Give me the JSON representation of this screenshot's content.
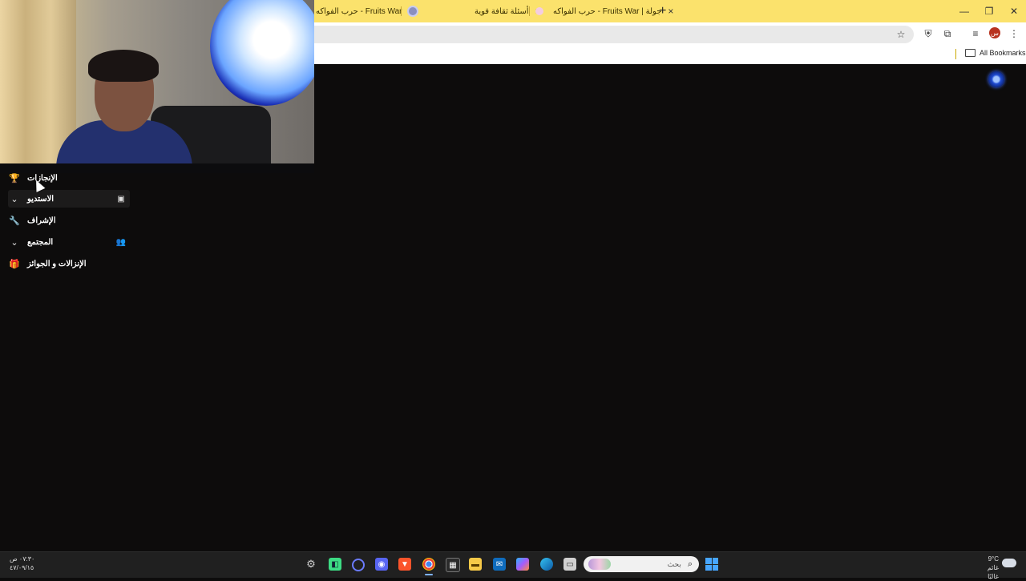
{
  "browser": {
    "tabs": [
      {
        "title": "حرب الفواكه - Fruits War",
        "active": false
      },
      {
        "title": "أسئلة ثقافة قوية",
        "active": true
      },
      {
        "title": "حرب الفواكه - Fruits War | جولة",
        "active": false
      }
    ],
    "close_glyph": "×",
    "new_tab_glyph": "+",
    "window_controls": {
      "minimize": "—",
      "maximize": "❐",
      "close": "✕"
    },
    "profile_initial": "س",
    "bookmarks": {
      "folder_label": "All Bookmarks"
    }
  },
  "sidebar": {
    "items": [
      {
        "label": "الإنجازات",
        "lead_icon": "trophy-icon",
        "lead_glyph": "🏆",
        "trail_icon": "",
        "trail_glyph": ""
      },
      {
        "label": "الاستديو",
        "lead_icon": "chevron-down-icon",
        "lead_glyph": "⌄",
        "trail_icon": "studio-icon",
        "trail_glyph": "▣"
      },
      {
        "label": "الإشراف",
        "lead_icon": "wrench-icon",
        "lead_glyph": "🔧",
        "trail_icon": "",
        "trail_glyph": ""
      },
      {
        "label": "المجتمع",
        "lead_icon": "chevron-down-icon",
        "lead_glyph": "⌄",
        "trail_icon": "group-add-icon",
        "trail_glyph": "👥"
      },
      {
        "label": "الإنزالات و الجوائز",
        "lead_icon": "gifts-icon",
        "lead_glyph": "🎁",
        "trail_icon": "",
        "trail_glyph": ""
      }
    ]
  },
  "taskbar": {
    "time": "٠٧:٣٠ ص",
    "date": "٤٧/٠٩/١٥",
    "search_placeholder": "بحث",
    "weather_temp": "9°C",
    "weather_desc": "غائم غالبًا",
    "apps": [
      "settings-icon",
      "android-studio-icon",
      "cortana-icon",
      "discord-icon",
      "brave-icon",
      "chrome-icon",
      "store-icon",
      "file-explorer-icon",
      "outlook-icon",
      "copilot-icon",
      "edge-icon",
      "window-icon"
    ]
  },
  "colors": {
    "tab_bar": "#fbe26c",
    "page_bg": "#0d0c0c",
    "taskbar_bg": "#202020"
  }
}
